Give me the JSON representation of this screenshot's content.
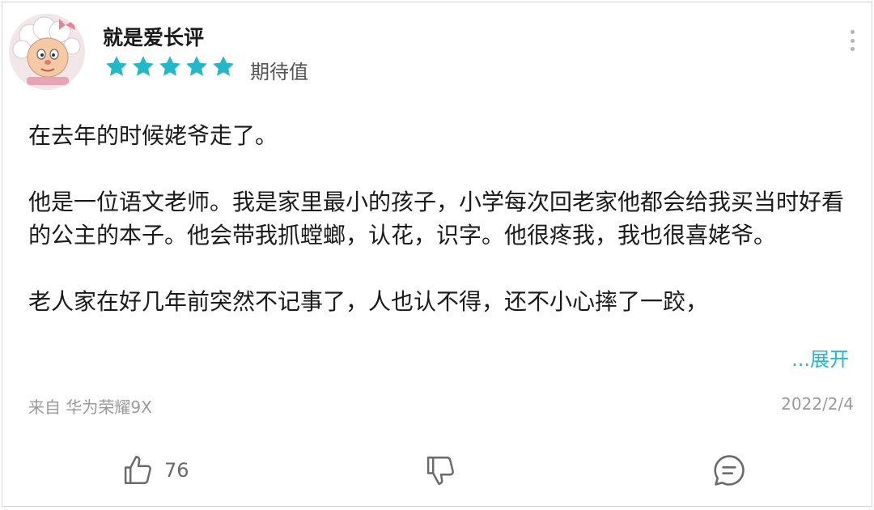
{
  "review": {
    "username": "就是爱长评",
    "rating_stars": 5,
    "rating_label": "期待值",
    "paragraphs": [
      "在去年的时候姥爷走了。",
      "他是一位语文老师。我是家里最小的孩子，小学每次回老家他都会给我买当时好看的公主的本子。他会带我抓螳螂，认花，识字。他很疼我，我也很喜姥爷。",
      "老人家在好几年前突然不记事了，人也认不得，还不小心摔了一跤，"
    ],
    "expand_label": "...展开",
    "source": "来自 华为荣耀9X",
    "date": "2022/2/4",
    "like_count": "76"
  },
  "colors": {
    "accent": "#21b8c9",
    "star": "#21b8c9",
    "text": "#1a1a1a",
    "meta": "#9a9a9a",
    "icon": "#6a6a6a"
  },
  "icons": {
    "more": "more-vertical-icon",
    "like": "thumbs-up-icon",
    "dislike": "thumbs-down-icon",
    "comment": "comment-icon",
    "star": "star-icon"
  }
}
